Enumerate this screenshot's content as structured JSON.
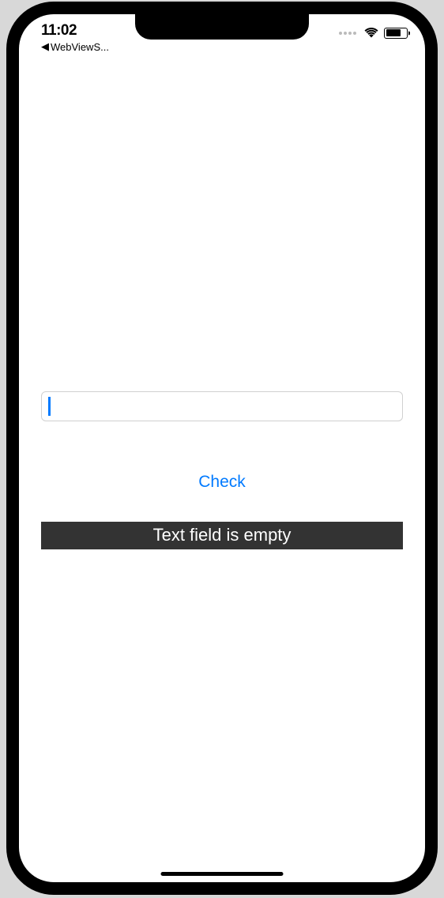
{
  "statusBar": {
    "time": "11:02",
    "backLabel": "WebViewS..."
  },
  "input": {
    "value": ""
  },
  "checkButton": {
    "label": "Check"
  },
  "result": {
    "text": "Text field is empty"
  }
}
